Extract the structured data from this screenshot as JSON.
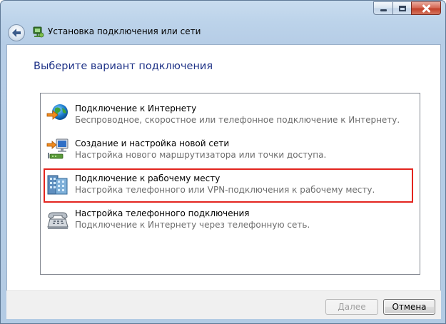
{
  "window": {
    "title": "Установка подключения или сети"
  },
  "content": {
    "heading": "Выберите вариант подключения",
    "options": [
      {
        "title": "Подключение к Интернету",
        "description": "Беспроводное, скоростное или телефонное подключение к Интернету.",
        "icon": "globe-network-icon"
      },
      {
        "title": "Создание и настройка новой сети",
        "description": "Настройка нового маршрутизатора или точки доступа.",
        "icon": "network-computer-icon"
      },
      {
        "title": "Подключение к рабочему месту",
        "description": "Настройка телефонного или VPN-подключения к рабочему месту.",
        "icon": "workplace-building-icon",
        "highlighted": true
      },
      {
        "title": "Настройка телефонного подключения",
        "description": "Подключение к Интернету через телефонную сеть.",
        "icon": "telephone-modem-icon"
      }
    ]
  },
  "footer": {
    "next_label": "Далее",
    "next_enabled": false,
    "cancel_label": "Отмена"
  },
  "colors": {
    "heading": "#1e3287",
    "highlight_border": "#e3251f",
    "description_text": "#6d6d6d"
  }
}
